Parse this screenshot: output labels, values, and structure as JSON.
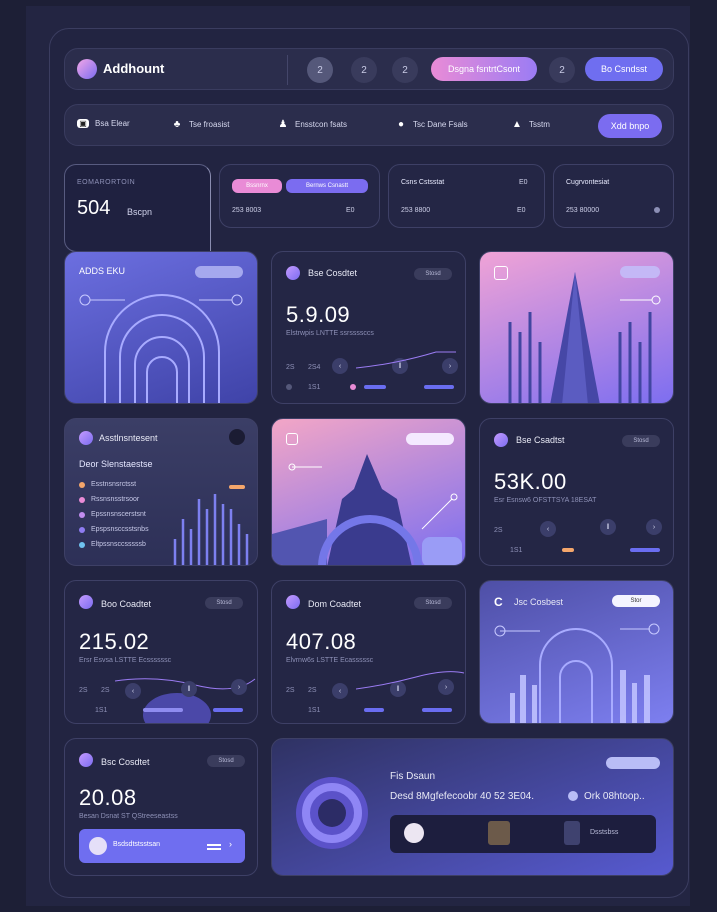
{
  "header": {
    "app_title": "Addhount",
    "step_buttons": [
      "2",
      "2",
      "2"
    ],
    "primary_pill": "Dsgna fsntrtCsont",
    "last_step": "2",
    "secondary_pill": "Bo Csndsst"
  },
  "nav": {
    "items": [
      {
        "label": "Bsa Elear",
        "icon": "file-icon"
      },
      {
        "label": "Tse froasist",
        "icon": "users-icon"
      },
      {
        "label": "Ensstcon fsats",
        "icon": "group-icon"
      },
      {
        "label": "Tsc Dane Fsals",
        "icon": "user-icon"
      },
      {
        "label": "Tsstm",
        "icon": "profile-icon"
      }
    ],
    "action_label": "Xdd bnpo"
  },
  "stats": {
    "main": {
      "label": "EOMARORTOIN",
      "value": "504",
      "unit": "Bscpn"
    },
    "card1": {
      "tag1": "Bssnrnx",
      "tag2": "Bernws Csnastt",
      "value": "253 8003",
      "right": "E0"
    },
    "card2": {
      "title": "Csns Cstsstat",
      "right_top": "E0",
      "value": "253 8800",
      "right": "E0"
    },
    "card3": {
      "title": "Cugrvontesiat",
      "value": "253 80000"
    }
  },
  "panels": {
    "p1": {
      "title": "ADDS EKU"
    },
    "p2": {
      "title": "Bse Cosdtet",
      "tag": "Stosd",
      "value": "5.9.09",
      "sub": "Elstrwpis LNTTE ssrssssccs",
      "left_a": "2S",
      "left_b": "2S4",
      "page": "1S1"
    },
    "p4": {
      "title": "Asstlnsntesent",
      "subtitle": "Deor Slenstaestse",
      "rows": [
        "Esstnsnsrctsst",
        "Rssnsnsstrsoor",
        "Epssnsnscerstsnt",
        "Epspsnsccsstsnbs",
        "Eltpssnsccsssssb"
      ]
    },
    "p6": {
      "title": "Bse Csadtst",
      "tag": "Stosd",
      "value": "53K.00",
      "sub": "Esr Esnsw6 OFSTTSYA 18ESAT",
      "left_a": "2S",
      "page": "1S1"
    },
    "p7": {
      "title": "Boo Coadtet",
      "tag": "Stosd",
      "value": "215.02",
      "sub": "Ersr Esvsa LSTTE Ecssssssc",
      "left_a": "2S",
      "left_b": "2S",
      "page": "1S1"
    },
    "p8": {
      "title": "Dom Coadtet",
      "tag": "Stosd",
      "value": "407.08",
      "sub": "Elvrnw6s LSTTE Ecasssssc",
      "left_a": "2S",
      "left_b": "2S",
      "page": "1S1"
    },
    "p9": {
      "title": "Jsc Cosbest",
      "tag": "Stor"
    },
    "p10": {
      "title": "Bsc Cosdtet",
      "tag": "Stosd",
      "value": "20.08",
      "sub": "Besan Dsnat ST QStreeseastss",
      "bar_label": "Bsdsdtstsstsan"
    },
    "p11": {
      "title": "Fis Dsaun",
      "line": "Desd 8Mgfefecoobr 40 52 3E04.",
      "right": "Ork 08htoop..",
      "caption": "Dsstsbss"
    }
  },
  "colors": {
    "accent": "#7b6cf0",
    "pink": "#e98bd6",
    "bg": "#1d1f36"
  }
}
